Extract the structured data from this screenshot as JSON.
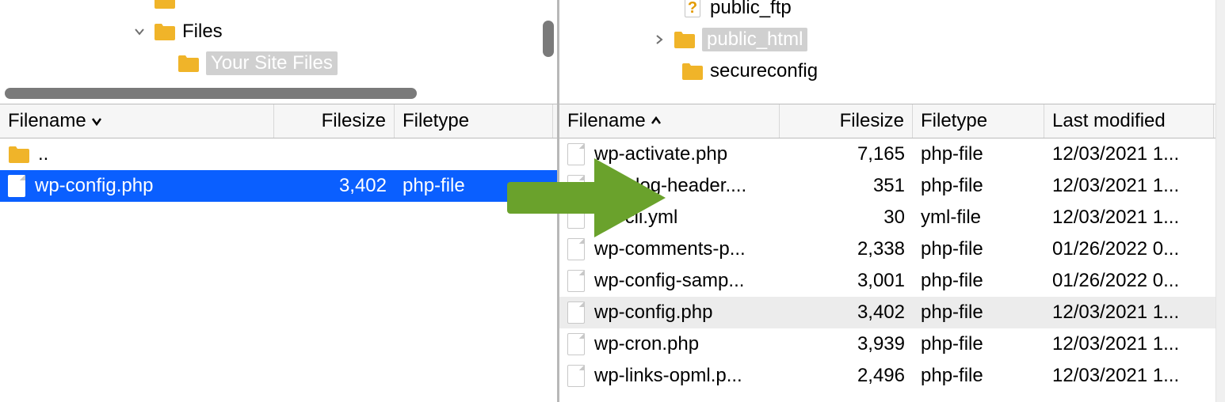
{
  "left": {
    "tree": {
      "items": [
        {
          "label": "Files",
          "indent": 170,
          "chevron": "down",
          "icon": "folder"
        },
        {
          "label": "Your Site Files",
          "indent": 224,
          "chevron": "none",
          "icon": "folder",
          "selected": true
        }
      ]
    },
    "headers": {
      "filename": "Filename",
      "filesize": "Filesize",
      "filetype": "Filetype",
      "sort": "desc"
    },
    "rows": [
      {
        "name": "..",
        "icon": "folder",
        "size": "",
        "type": ""
      },
      {
        "name": "wp-config.php",
        "icon": "file",
        "size": "3,402",
        "type": "php-file",
        "selected": true
      }
    ]
  },
  "right": {
    "tree": {
      "items": [
        {
          "label": "public_ftp",
          "indent": 154,
          "chevron": "none",
          "icon": "question"
        },
        {
          "label": "public_html",
          "indent": 154,
          "chevron": "right",
          "icon": "folder",
          "selected": true
        },
        {
          "label": "secureconfig",
          "indent": 154,
          "chevron": "none",
          "icon": "folder"
        }
      ]
    },
    "headers": {
      "filename": "Filename",
      "filesize": "Filesize",
      "filetype": "Filetype",
      "lastmod": "Last modified",
      "sort": "asc"
    },
    "rows": [
      {
        "name": "wp-activate.php",
        "icon": "file",
        "size": "7,165",
        "type": "php-file",
        "mod": "12/03/2021 1..."
      },
      {
        "name": "wp-blog-header....",
        "icon": "file",
        "size": "351",
        "type": "php-file",
        "mod": "12/03/2021 1..."
      },
      {
        "name": "wp-cli.yml",
        "icon": "file",
        "size": "30",
        "type": "yml-file",
        "mod": "12/03/2021 1..."
      },
      {
        "name": "wp-comments-p...",
        "icon": "file",
        "size": "2,338",
        "type": "php-file",
        "mod": "01/26/2022 0..."
      },
      {
        "name": "wp-config-samp...",
        "icon": "file",
        "size": "3,001",
        "type": "php-file",
        "mod": "01/26/2022 0..."
      },
      {
        "name": "wp-config.php",
        "icon": "file",
        "size": "3,402",
        "type": "php-file",
        "mod": "12/03/2021 1...",
        "highlight": true
      },
      {
        "name": "wp-cron.php",
        "icon": "file",
        "size": "3,939",
        "type": "php-file",
        "mod": "12/03/2021 1..."
      },
      {
        "name": "wp-links-opml.p...",
        "icon": "file",
        "size": "2,496",
        "type": "php-file",
        "mod": "12/03/2021 1..."
      }
    ]
  }
}
